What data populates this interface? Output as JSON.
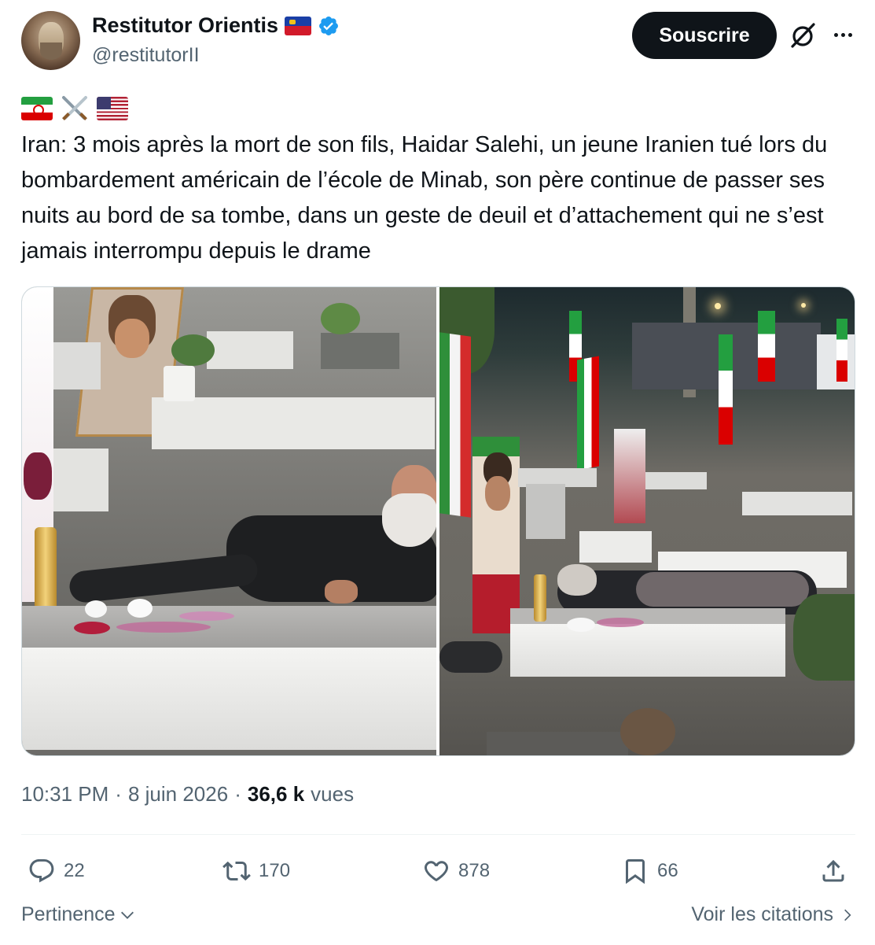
{
  "author": {
    "display_name": "Restitutor Orientis",
    "handle": "@restitutorII",
    "avatar_icon": "roman-bust-avatar",
    "flag_icon": "liechtenstein-flag-icon",
    "verified_icon": "verified-badge-icon",
    "verified_color": "#1d9bf0"
  },
  "header": {
    "subscribe_label": "Souscrire",
    "grok_icon": "grok-icon",
    "more_icon": "more-dots-icon"
  },
  "tweet": {
    "emoji": [
      "iran-flag-icon",
      "crossed-swords-icon",
      "us-flag-icon"
    ],
    "text": "Iran: 3 mois après la mort de son fils, Haidar Salehi, un jeune Iranien tué lors du bombardement américain de l’école de Minab, son père continue de passer ses nuits au bord de sa tombe, dans un geste de deuil et d’attachement qui ne s’est jamais interrompu depuis le drame"
  },
  "media": {
    "photos": [
      {
        "name": "photo-left",
        "subject": "man lying beside white grave with lantern and flowers"
      },
      {
        "name": "photo-right",
        "subject": "cemetery at night with Iranian flags, man lying beside grave"
      }
    ]
  },
  "meta": {
    "time": "10:31 PM",
    "sep1": "·",
    "date": "8 juin 2026",
    "sep2": "·",
    "views_count": "36,6 k",
    "views_label": "vues"
  },
  "actions": {
    "replies": "22",
    "reposts": "170",
    "likes": "878",
    "bookmarks": "66"
  },
  "footer": {
    "sort_label": "Pertinence",
    "quotes_label": "Voir les citations"
  },
  "colors": {
    "text": "#0f1419",
    "secondary": "#536471",
    "button_bg": "#0f1419",
    "verified": "#1d9bf0"
  }
}
